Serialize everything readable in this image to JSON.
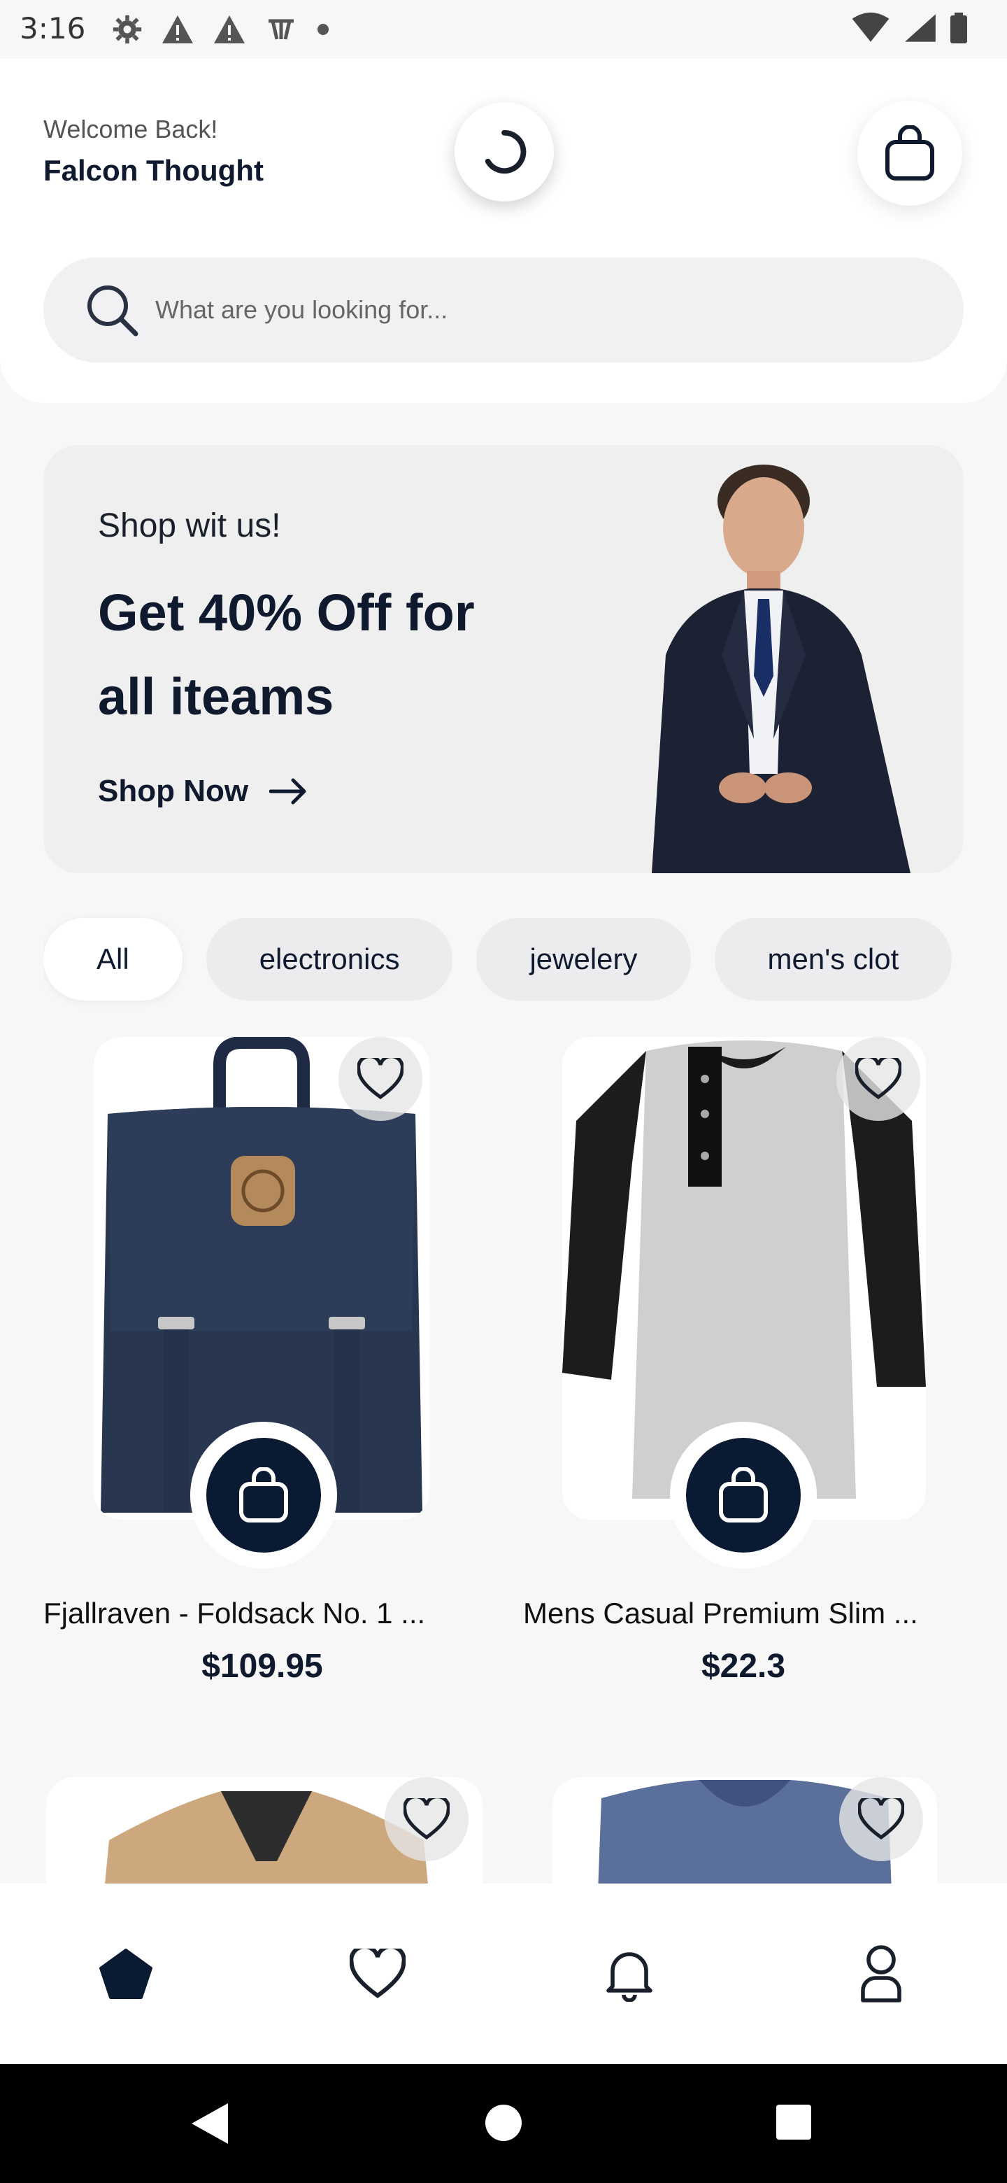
{
  "status_bar": {
    "time": "3:16"
  },
  "header": {
    "welcome": "Welcome Back!",
    "user_name": "Falcon Thought"
  },
  "search": {
    "placeholder": "What are you looking for..."
  },
  "banner": {
    "kicker": "Shop wit us!",
    "headline": "Get 40% Off for all iteams",
    "cta": "Shop Now"
  },
  "categories": {
    "selected": "All",
    "items": [
      "All",
      "electronics",
      "jewelery",
      "men's clot"
    ]
  },
  "products": [
    {
      "title": "Fjallraven - Foldsack No. 1 ...",
      "price": "$109.95"
    },
    {
      "title": "Mens Casual Premium Slim ...",
      "price": "$22.3"
    }
  ],
  "colors": {
    "primary": "#0b1a33",
    "background": "#f7f7f8",
    "chip": "#ececef"
  },
  "bottom_nav": [
    "home-icon",
    "heart-icon",
    "bell-icon",
    "profile-icon"
  ]
}
